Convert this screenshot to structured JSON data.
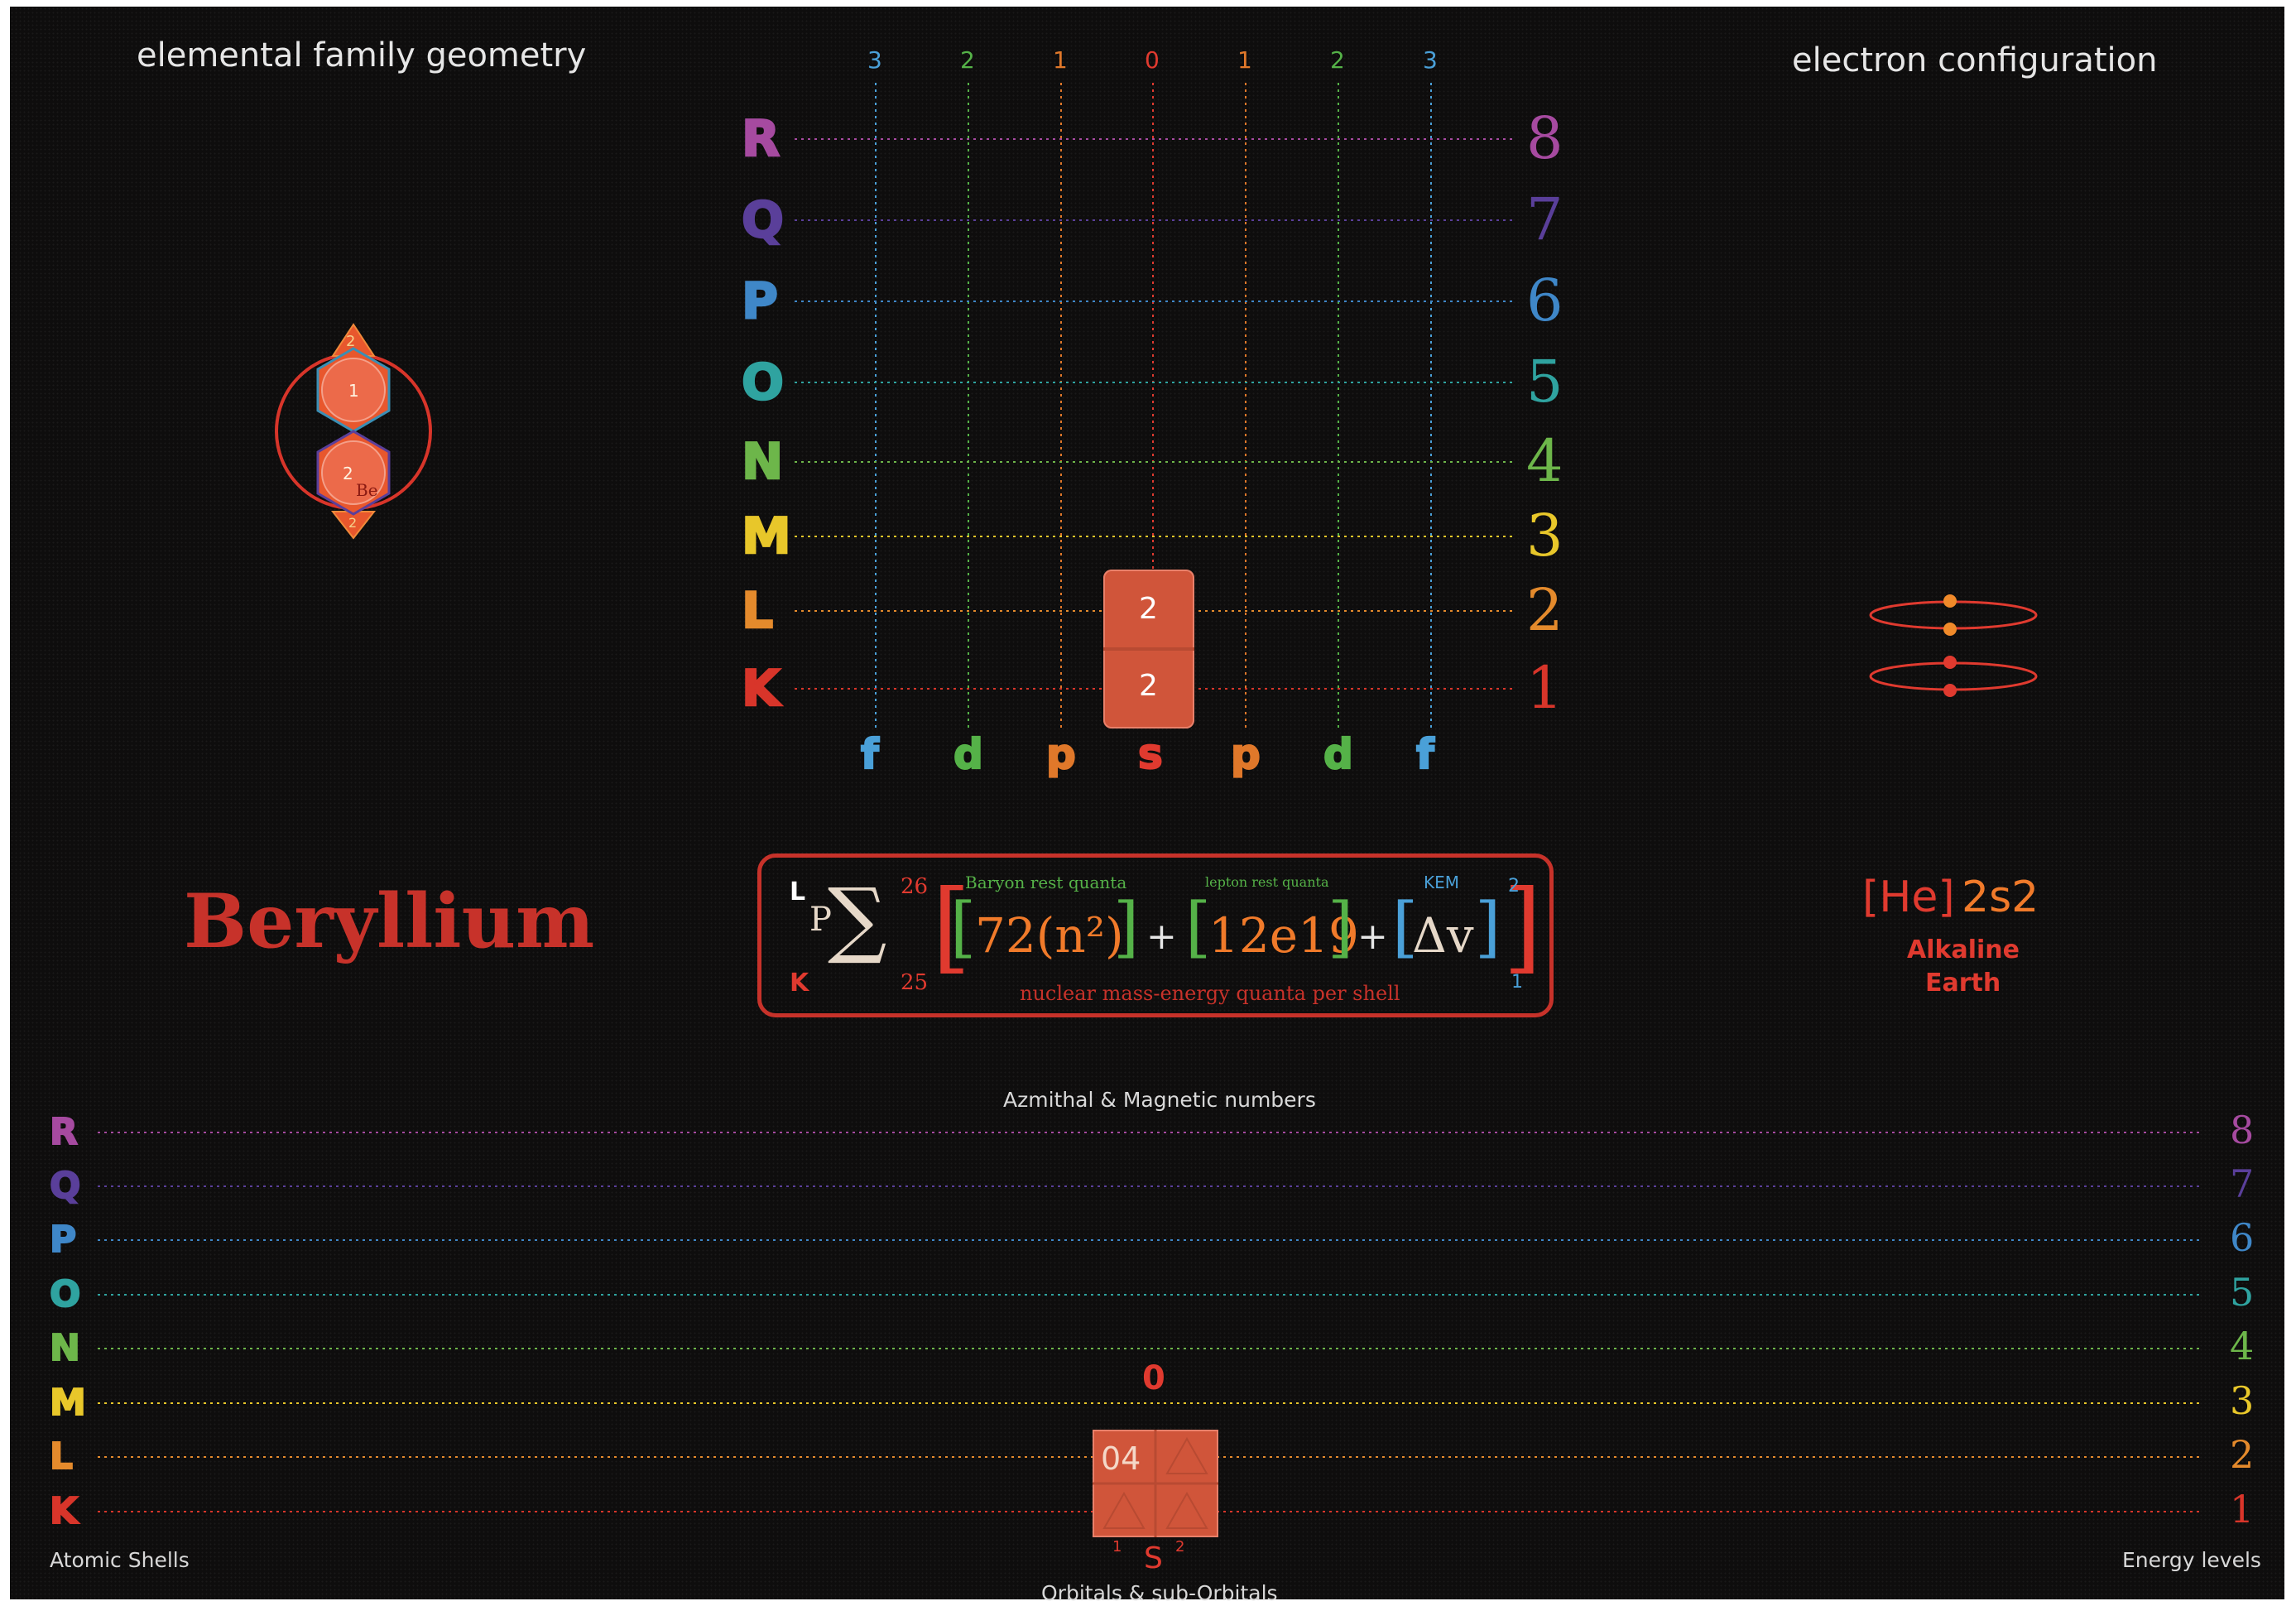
{
  "headers": {
    "left": "elemental family geometry",
    "right": "electron configuration"
  },
  "grid": {
    "top_numbers": [
      "3",
      "2",
      "1",
      "0",
      "1",
      "2",
      "3"
    ],
    "top_number_colors": [
      "#4aa0d8",
      "#55b248",
      "#e0782a",
      "#e03a2f",
      "#e0782a",
      "#55b248",
      "#4aa0d8"
    ],
    "bottom_letters": [
      "f",
      "d",
      "p",
      "s",
      "p",
      "d",
      "f"
    ],
    "bottom_letter_colors": [
      "#4aa0d8",
      "#55b248",
      "#e0782a",
      "#e03a2f",
      "#e0782a",
      "#55b248",
      "#4aa0d8"
    ],
    "shells": [
      "R",
      "Q",
      "P",
      "O",
      "N",
      "M",
      "L",
      "K"
    ],
    "levels": [
      "8",
      "7",
      "6",
      "5",
      "4",
      "3",
      "2",
      "1"
    ],
    "row_colors": [
      "#a64aa0",
      "#5a3f9a",
      "#3f87c8",
      "#2fa3a0",
      "#6db64a",
      "#e8c72a",
      "#e48a2c",
      "#d8352a"
    ],
    "orbital_cells": [
      "2",
      "2"
    ]
  },
  "element": {
    "name": "Beryllium",
    "config_core": "[He]",
    "config_value": "2s2",
    "family": [
      "Alkaline",
      "Earth"
    ]
  },
  "geometry": {
    "top_number": "2",
    "inner_top": "1",
    "inner_bottom": "2",
    "symbol": "Be",
    "bottom_number": "2"
  },
  "formula": {
    "upper": "L",
    "lower": "K",
    "upper_index": "26",
    "lower_index": "25",
    "p": "P",
    "term1": "72(n²)",
    "term2": "12e19",
    "term3": "Δv",
    "plus": "+",
    "label1": "Baryon rest quanta",
    "label2": "lepton rest quanta",
    "label3": "KEM",
    "exp_top": "2",
    "exp_bottom": "1",
    "caption": "nuclear mass-energy quanta per shell"
  },
  "bottom": {
    "title": "Azmithal & Magnetic numbers",
    "shells": [
      "R",
      "Q",
      "P",
      "O",
      "N",
      "M",
      "L",
      "K"
    ],
    "levels": [
      "8",
      "7",
      "6",
      "5",
      "4",
      "3",
      "2",
      "1"
    ],
    "magnetic_value": "0",
    "box_value": "04",
    "sub_left": "1",
    "sub_letter": "S",
    "sub_right": "2",
    "left_caption": "Atomic Shells",
    "right_caption": "Energy levels",
    "bottom_caption": "Orbitals & sub-Orbitals"
  }
}
